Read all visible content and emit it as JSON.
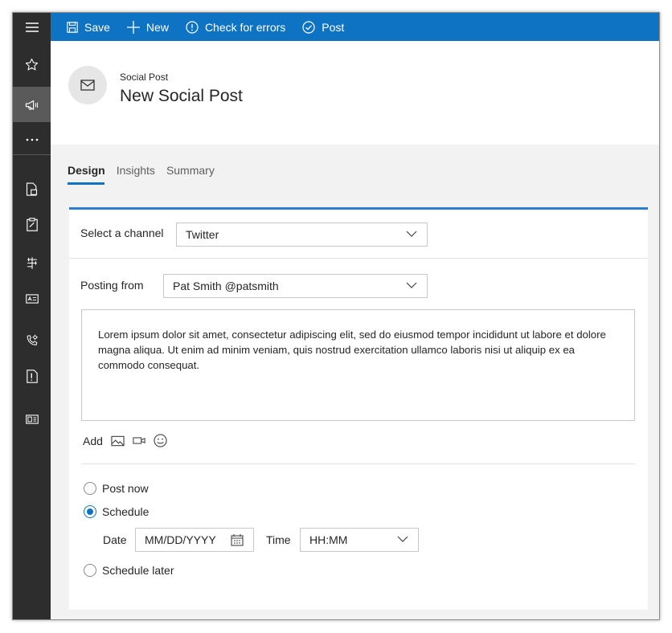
{
  "rail": {
    "items": [
      {
        "icon": "hamburger-menu-icon"
      },
      {
        "icon": "star-icon"
      },
      {
        "icon": "megaphone-icon"
      },
      {
        "icon": "more-icon",
        "label": "..."
      },
      {
        "icon": "document-icon"
      },
      {
        "icon": "clipboard-icon"
      },
      {
        "icon": "flow-icon"
      },
      {
        "icon": "card-icon"
      },
      {
        "icon": "phone-settings-icon"
      },
      {
        "icon": "alert-document-icon"
      },
      {
        "icon": "id-card-icon"
      }
    ]
  },
  "toolbar": {
    "save_label": "Save",
    "new_label": "New",
    "check_label": "Check for errors",
    "post_label": "Post"
  },
  "header": {
    "entity": "Social Post",
    "title": "New Social Post"
  },
  "tabs": [
    {
      "label": "Design",
      "active": true
    },
    {
      "label": "Insights",
      "active": false
    },
    {
      "label": "Summary",
      "active": false
    }
  ],
  "form": {
    "channel_label": "Select a channel",
    "channel_value": "Twitter",
    "posting_from_label": "Posting from",
    "posting_from_value": "Pat Smith @patsmith",
    "message": "Lorem ipsum dolor sit amet, consectetur adipiscing elit, sed do eiusmod tempor incididunt ut labore et dolore magna aliqua. Ut enim ad minim veniam, quis nostrud exercitation ullamco laboris nisi ut aliquip ex ea commodo consequat.",
    "add_label": "Add",
    "post_now_label": "Post now",
    "schedule_label": "Schedule",
    "schedule_later_label": "Schedule later",
    "selected_option": "Schedule",
    "date_label": "Date",
    "date_placeholder": "MM/DD/YYYY",
    "time_label": "Time",
    "time_placeholder": "HH:MM"
  },
  "colors": {
    "accent": "#0f73c3",
    "rail": "#2d2d2d",
    "rail_active": "#5a5a5a"
  }
}
